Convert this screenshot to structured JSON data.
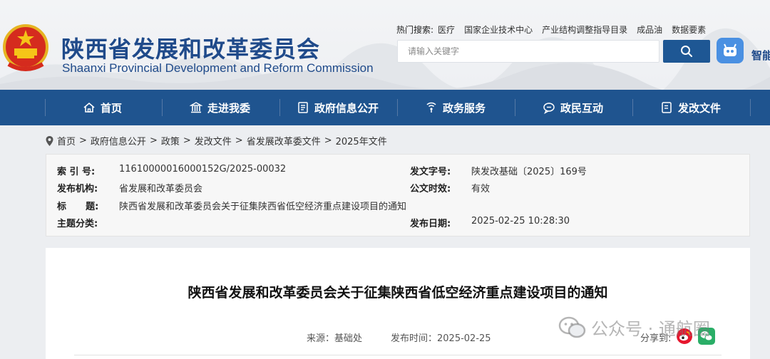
{
  "header": {
    "title": "陕西省发展和改革委员会",
    "subtitle": "Shaanxi Provincial Development and Reform Commission",
    "hot_search_label": "热门搜索:",
    "hot_search_links": [
      "医疗",
      "国家企业技术中心",
      "产业结构调整指导目录",
      "成品油",
      "数据要素"
    ],
    "search_placeholder": "请输入关键字",
    "assistant_label": "智能"
  },
  "nav": {
    "items": [
      {
        "label": "首页",
        "icon": "home-icon"
      },
      {
        "label": "走进我委",
        "icon": "building-icon"
      },
      {
        "label": "政府信息公开",
        "icon": "document-icon"
      },
      {
        "label": "政务服务",
        "icon": "signal-icon"
      },
      {
        "label": "政民互动",
        "icon": "chat-icon"
      },
      {
        "label": "发改文件",
        "icon": "file-icon"
      }
    ]
  },
  "breadcrumb": [
    "首页",
    "政府信息公开",
    "政策",
    "发改文件",
    "省发展改革委文件",
    "2025年文件"
  ],
  "meta": {
    "index_key": "索 引 号:",
    "index_val": "11610000016000152G/2025-00032",
    "doc_no_key": "发文字号:",
    "doc_no_val": "陕发改基础〔2025〕169号",
    "publisher_key": "发布机构:",
    "publisher_val": "省发展和改革委员会",
    "validity_key": "公文时效:",
    "validity_val": "有效",
    "title_key": "标      题:",
    "title_val": "陕西省发展和改革委员会关于征集陕西省低空经济重点建设项目的通知",
    "topic_key": "主题分类:",
    "topic_val": "",
    "date_key": "发布日期:",
    "date_val": "2025-02-25 10:28:30"
  },
  "article": {
    "title": "陕西省发展和改革委员会关于征集陕西省低空经济重点建设项目的通知",
    "source": "来源：基础处",
    "published": "发布时间：2025-02-25",
    "share_label": "分享到:"
  },
  "watermark": {
    "text": "公众号 · 通航圈"
  },
  "colors": {
    "brand_blue": "#1f548f",
    "title_blue": "#1f4a8a",
    "search_button": "#1e5794",
    "assistant_button": "#4a90e2"
  }
}
